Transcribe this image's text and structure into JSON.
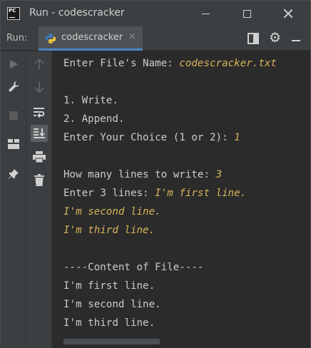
{
  "window": {
    "title": "Run - codescracker",
    "app_icon_text": "PC"
  },
  "tabbar": {
    "run_label": "Run:",
    "tab_label": "codescracker",
    "tab_close": "×"
  },
  "console": {
    "lines": [
      {
        "text": "Enter File's Name: ",
        "input": "codescracker.txt"
      },
      {
        "text": "",
        "input": ""
      },
      {
        "text": "1. Write.",
        "input": ""
      },
      {
        "text": "2. Append.",
        "input": ""
      },
      {
        "text": "Enter Your Choice (1 or 2): ",
        "input": "1"
      },
      {
        "text": "",
        "input": ""
      },
      {
        "text": "How many lines to write: ",
        "input": "3"
      },
      {
        "text": "Enter 3 lines: ",
        "input": "I'm first line."
      },
      {
        "text": "",
        "input": "I'm second line."
      },
      {
        "text": "",
        "input": "I'm third line."
      },
      {
        "text": "",
        "input": ""
      },
      {
        "text": "----Content of File----",
        "input": ""
      },
      {
        "text": "I'm first line.",
        "input": ""
      },
      {
        "text": "I'm second line.",
        "input": ""
      },
      {
        "text": "I'm third line.",
        "input": ""
      }
    ]
  },
  "colors": {
    "background": "#2b2b2b",
    "panel": "#3c3f41",
    "text": "#cccccc",
    "user_input": "#d7b45a",
    "tab_accent": "#4a88c7"
  }
}
